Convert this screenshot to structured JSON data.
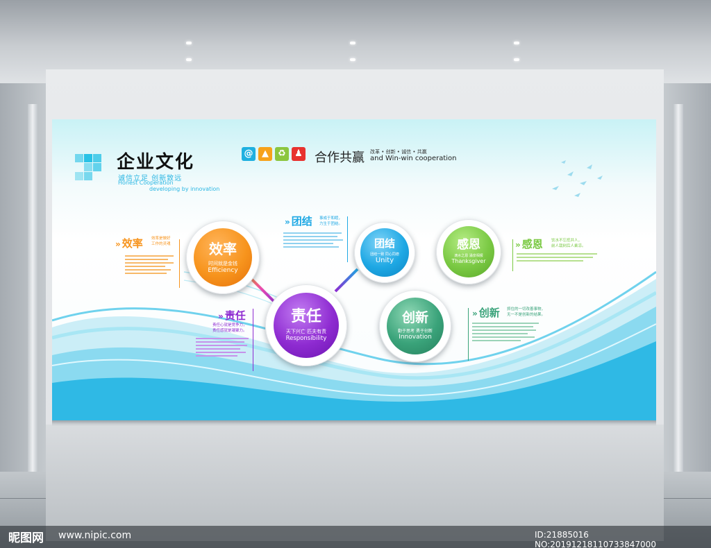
{
  "header": {
    "title": "企业文化",
    "subtitle_zh": "诚信立足  创新致远",
    "subtitle_en_1": "Honest Cooperation",
    "subtitle_en_2": "developing by innovation"
  },
  "slogan": {
    "icons": [
      {
        "name": "at-icon",
        "glyph": "@",
        "color": "#1fb0e0"
      },
      {
        "name": "chart-icon",
        "glyph": "▲",
        "color": "#f7a21b"
      },
      {
        "name": "recycle-icon",
        "glyph": "♻",
        "color": "#8cc63f"
      },
      {
        "name": "person-icon",
        "glyph": "♟",
        "color": "#e8322f"
      }
    ],
    "text_zh": "合作共赢",
    "small_text": "改革 • 创新 • 诚信 • 共赢",
    "text_en": "and Win-win  cooperation"
  },
  "nodes": {
    "efficiency": {
      "zh": "效率",
      "line1": "时间就是金钱",
      "line2": "Efficiency"
    },
    "unity": {
      "zh": "团结",
      "line1": "团结一致  同心同德",
      "line2": "Unity"
    },
    "gratitude": {
      "zh": "感恩",
      "line1": "滴水之恩  涌泉相报",
      "line2": "Thanksgiver"
    },
    "responsibility": {
      "zh": "责任",
      "line1": "天下兴亡  匹夫有责",
      "line2": "Responsibility"
    },
    "innovation": {
      "zh": "创新",
      "line1": "勤于思考  勇于创新",
      "line2": "Innovation"
    }
  },
  "sections": {
    "efficiency": {
      "heading": "效率",
      "note": "效率是做好\n工作的灵魂"
    },
    "unity": {
      "heading": "团结",
      "note": "事成于和睦，\n力生于团结。"
    },
    "gratitude": {
      "heading": "感恩",
      "note": "饮水不忘挖井人，\n前人栽树后人乘凉。"
    },
    "responsibility": {
      "heading": "责任",
      "note": "责任心就是竞争力，\n责任感就是凝聚力。"
    },
    "innovation": {
      "heading": "创新",
      "note": "抓住的一切改善事物，\n无一不是创新的结果。"
    }
  },
  "watermark": {
    "logo": "昵图网",
    "url": "www.nipic.com",
    "id": "ID:21885016 NO:20191218110733847000"
  },
  "colors": {
    "accent_blue": "#29c2e6",
    "efficiency": "#f7941d",
    "unity": "#1ea8e4",
    "gratitude": "#7ac943",
    "responsibility": "#8e2bd1",
    "innovation": "#3aa37a"
  }
}
